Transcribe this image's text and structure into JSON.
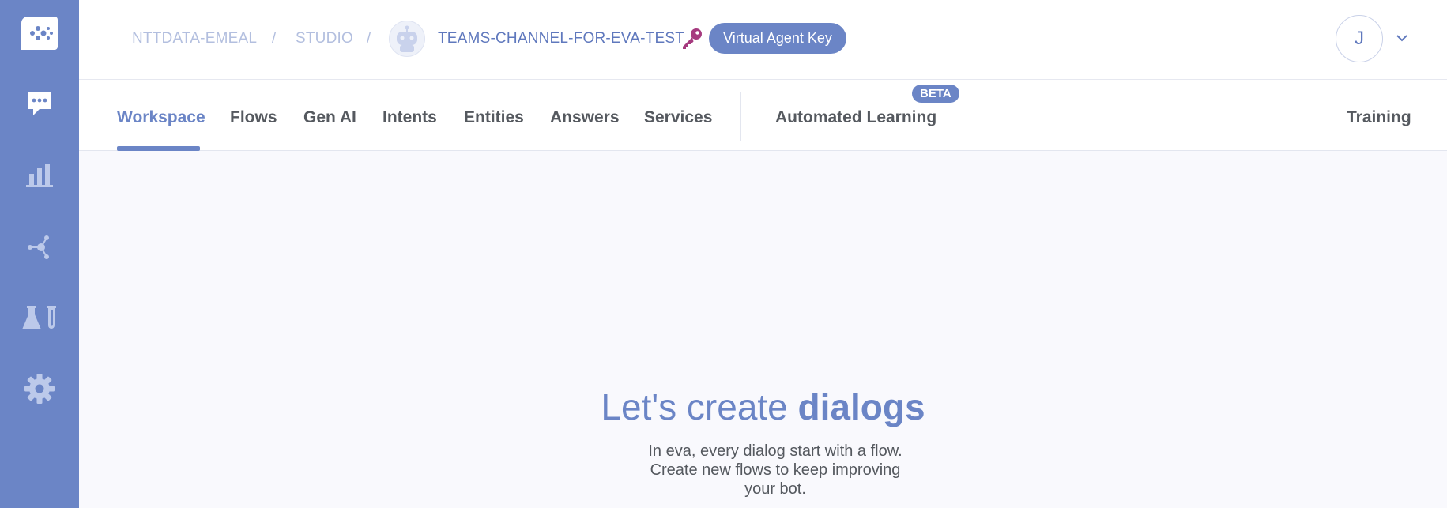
{
  "sidebar": {
    "icons": [
      "eva-logo-icon",
      "chat-bubble-icon",
      "bar-chart-icon",
      "network-icon",
      "lab-flask-icon",
      "gear-icon"
    ]
  },
  "header": {
    "breadcrumb": {
      "org": "NTTDATA-EMEAL",
      "sep1": "/",
      "section": "STUDIO",
      "sep2": "/",
      "bot": "TEAMS-CHANNEL-FOR-EVA-TEST"
    },
    "key_button": "Virtual Agent Key",
    "user_initial": "J"
  },
  "tabs": {
    "items": [
      "Workspace",
      "Flows",
      "Gen AI",
      "Intents",
      "Entities",
      "Answers",
      "Services",
      "Automated Learning",
      "Training"
    ],
    "active": "Workspace",
    "beta_badge": "BETA"
  },
  "empty_state": {
    "title_prefix": "Let's create",
    "title_bold": "dialogs",
    "description": "In eva, every dialog start with a flow. Create new flows to keep improving your bot."
  },
  "colors": {
    "sidebar": "#6b85c6",
    "accent": "#6b85c6",
    "key_icon": "#a63a7f"
  }
}
